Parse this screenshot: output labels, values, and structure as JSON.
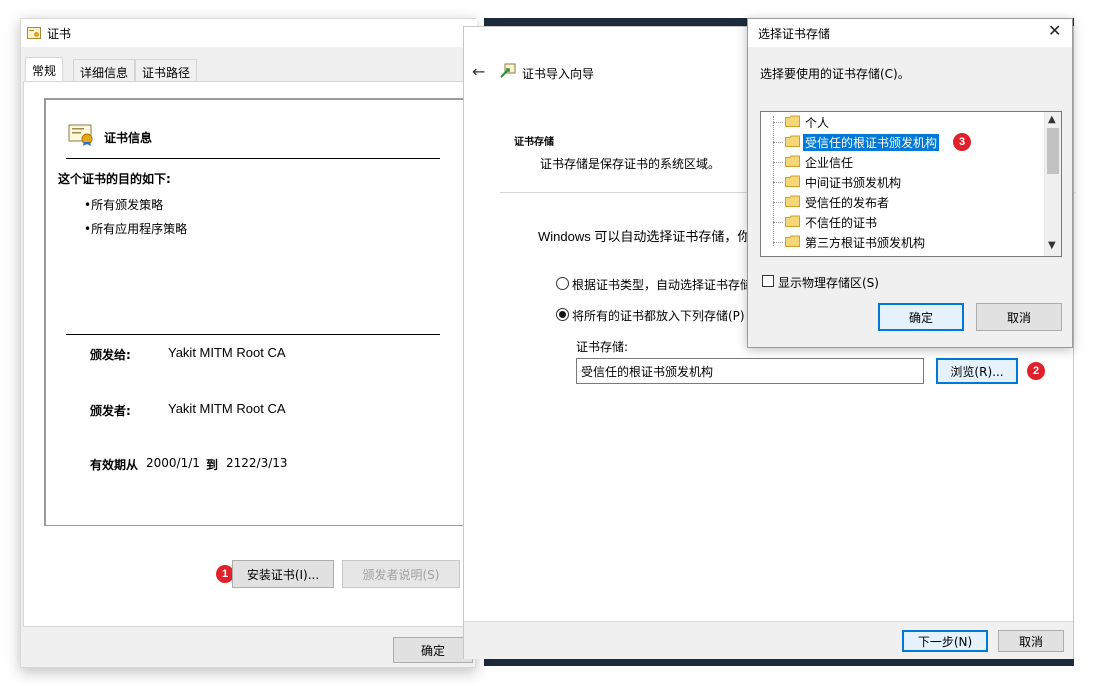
{
  "cert_window": {
    "title": "证书",
    "tabs": [
      "常规",
      "详细信息",
      "证书路径"
    ],
    "info_title": "证书信息",
    "purpose_heading": "这个证书的目的如下:",
    "purposes": [
      "•所有颁发策略",
      "•所有应用程序策略"
    ],
    "issued_to_label": "颁发给:",
    "issued_to_value": "Yakit MITM Root CA",
    "issued_by_label": "颁发者:",
    "issued_by_value": "Yakit MITM Root CA",
    "valid_from_label": "有效期从",
    "valid_from": "2000/1/1",
    "valid_to_label": "到",
    "valid_to": "2122/3/13",
    "install_button": "安装证书(I)...",
    "issuer_statement_button": "颁发者说明(S)",
    "ok_button": "确定"
  },
  "wizard": {
    "back_icon": "arrow-left-icon",
    "title": "证书导入向导",
    "section_heading": "证书存储",
    "section_desc": "证书存储是保存证书的系统区域。",
    "windows_text": "Windows 可以自动选择证书存储，你也",
    "radio_auto": "根据证书类型，自动选择证书存储",
    "radio_manual": "将所有的证书都放入下列存储(P)",
    "store_label": "证书存储:",
    "store_value": "受信任的根证书颁发机构",
    "browse_button": "浏览(R)...",
    "next_button": "下一步(N)",
    "cancel_button": "取消"
  },
  "dialog": {
    "title": "选择证书存储",
    "close_glyph": "✕",
    "prompt": "选择要使用的证书存储(C)。",
    "stores": [
      "个人",
      "受信任的根证书颁发机构",
      "企业信任",
      "中间证书颁发机构",
      "受信任的发布者",
      "不信任的证书",
      "第三方根证书颁发机构"
    ],
    "selected_index": 1,
    "show_physical": "显示物理存储区(S)",
    "ok_button": "确定",
    "cancel_button": "取消"
  },
  "markers": [
    "1",
    "2",
    "3"
  ],
  "colors": {
    "selection": "#0078d7",
    "marker": "#e0202a",
    "dark_strip": "#1c2a3a"
  }
}
